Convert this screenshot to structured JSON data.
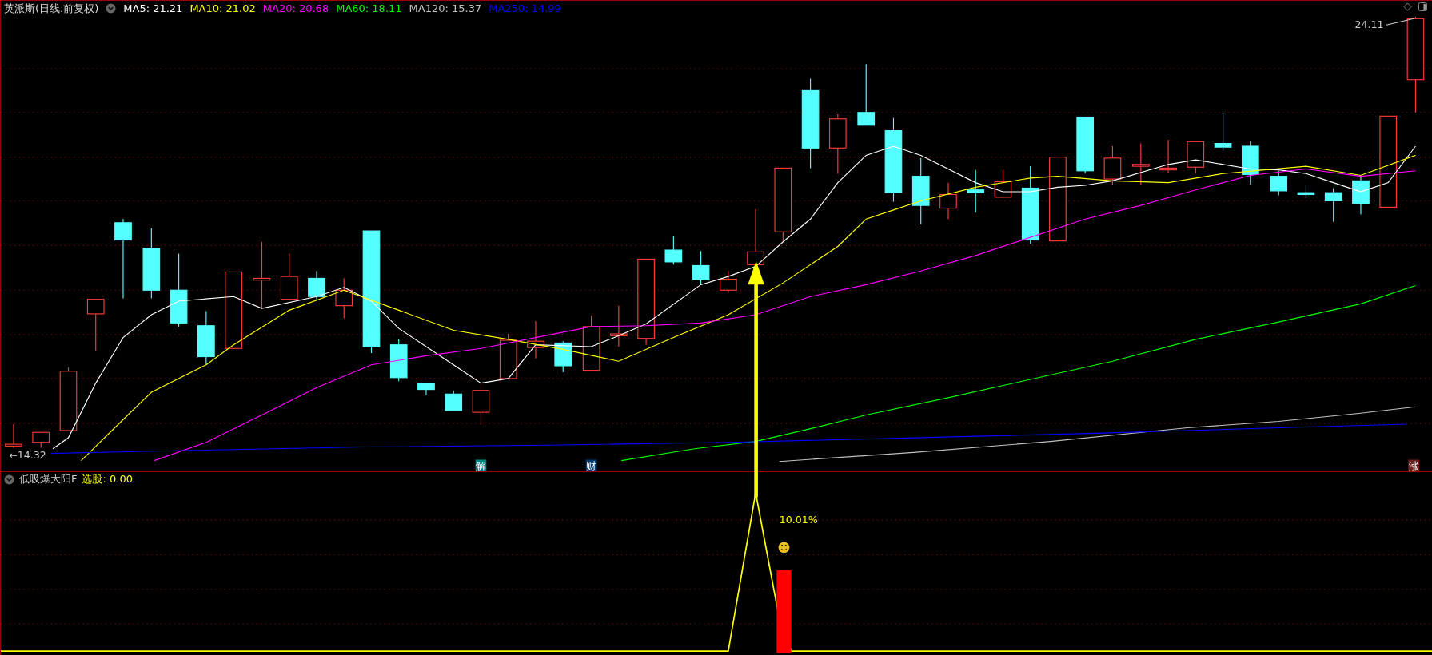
{
  "header": {
    "title": "英派斯(日线.前复权)",
    "indicators": [
      {
        "label": "MA5: 21.21",
        "color": "#ffffff"
      },
      {
        "label": "MA10: 21.02",
        "color": "#ffff00"
      },
      {
        "label": "MA20: 20.68",
        "color": "#ff00ff"
      },
      {
        "label": "MA60: 18.11",
        "color": "#00ff00"
      },
      {
        "label": "MA120: 15.37",
        "color": "#c0c0c0"
      },
      {
        "label": "MA250: 14.99",
        "color": "#0000ff"
      }
    ]
  },
  "price_labels": {
    "high": "24.11",
    "low": "←14.32"
  },
  "event_tags": [
    {
      "text": "解",
      "color": "#008080"
    },
    {
      "text": "财",
      "color": "#003a6e"
    },
    {
      "text": "涨",
      "color": "#6e1e1e"
    }
  ],
  "sub_panel": {
    "title": "低吸爆大阳F",
    "value": "选股: 0.00",
    "signal_label": "10.01%"
  }
}
